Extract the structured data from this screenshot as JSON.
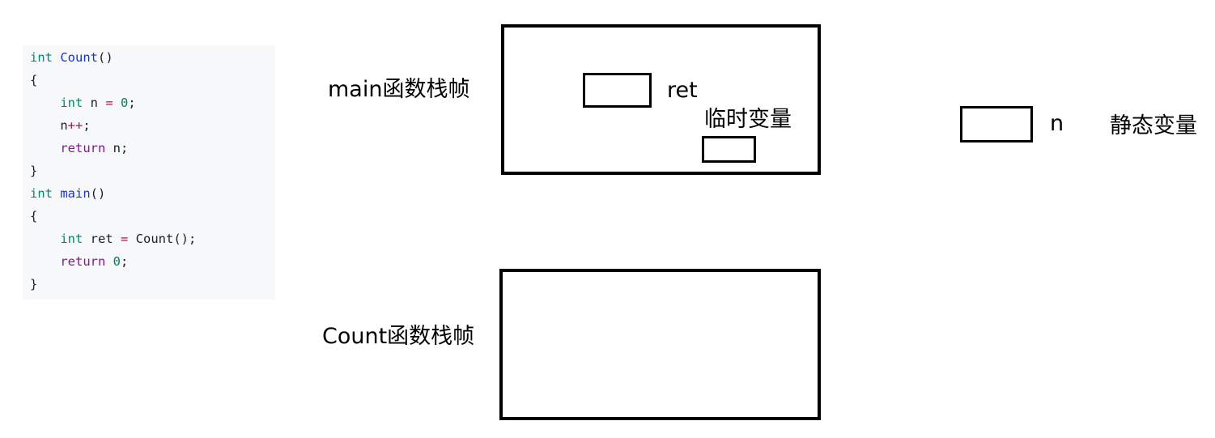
{
  "code": {
    "lines": [
      [
        {
          "t": "int",
          "c": "kw-type"
        },
        {
          "t": " ",
          "c": "plain"
        },
        {
          "t": "Count",
          "c": "fn-name"
        },
        {
          "t": "()",
          "c": "plain"
        }
      ],
      [
        {
          "t": "{",
          "c": "plain"
        }
      ],
      [
        {
          "t": "    ",
          "c": "plain"
        },
        {
          "t": "int",
          "c": "kw-type"
        },
        {
          "t": " n ",
          "c": "plain"
        },
        {
          "t": "=",
          "c": "op"
        },
        {
          "t": " ",
          "c": "plain"
        },
        {
          "t": "0",
          "c": "num"
        },
        {
          "t": ";",
          "c": "plain"
        }
      ],
      [
        {
          "t": "    n",
          "c": "plain"
        },
        {
          "t": "++",
          "c": "op"
        },
        {
          "t": ";",
          "c": "plain"
        }
      ],
      [
        {
          "t": "    ",
          "c": "plain"
        },
        {
          "t": "return",
          "c": "kw-ctrl"
        },
        {
          "t": " n;",
          "c": "plain"
        }
      ],
      [
        {
          "t": "}",
          "c": "plain"
        }
      ],
      [
        {
          "t": "int",
          "c": "kw-type"
        },
        {
          "t": " ",
          "c": "plain"
        },
        {
          "t": "main",
          "c": "fn-name"
        },
        {
          "t": "()",
          "c": "plain"
        }
      ],
      [
        {
          "t": "{",
          "c": "plain"
        }
      ],
      [
        {
          "t": "    ",
          "c": "plain"
        },
        {
          "t": "int",
          "c": "kw-type"
        },
        {
          "t": " ret ",
          "c": "plain"
        },
        {
          "t": "=",
          "c": "op"
        },
        {
          "t": " Count();",
          "c": "plain"
        }
      ],
      [
        {
          "t": "    ",
          "c": "plain"
        },
        {
          "t": "return",
          "c": "kw-ctrl"
        },
        {
          "t": " ",
          "c": "plain"
        },
        {
          "t": "0",
          "c": "num"
        },
        {
          "t": ";",
          "c": "plain"
        }
      ],
      [
        {
          "t": "}",
          "c": "plain"
        }
      ]
    ]
  },
  "diagram": {
    "main_frame_label": "main函数栈帧",
    "count_frame_label": "Count函数栈帧",
    "ret_label": "ret",
    "temp_label": "临时变量",
    "n_label": "n",
    "static_label": "静态变量"
  }
}
